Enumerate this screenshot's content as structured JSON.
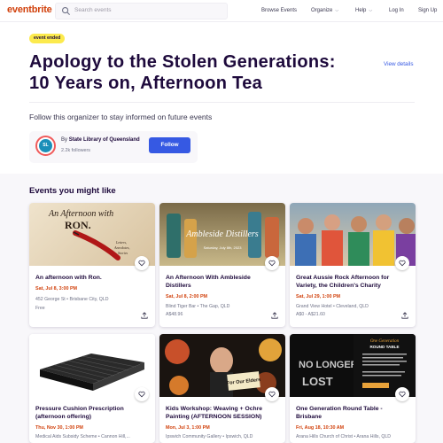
{
  "header": {
    "logo": "eventbrite",
    "search_placeholder": "Search events",
    "nav": [
      "Browse Events",
      "Organize",
      "Help",
      "Log In",
      "Sign Up"
    ]
  },
  "event": {
    "badge": "event ended",
    "title_line1": "Apology to the Stolen Generations:",
    "title_line2": "10 Years on, Afternoon Tea",
    "view_details": "View details"
  },
  "organizer": {
    "prompt": "Follow this organizer to stay informed on future events",
    "avatar_initials": "SL",
    "by_prefix": "By",
    "name": "State Library of Queensland",
    "followers": "2.2k followers",
    "follow_label": "Follow"
  },
  "related": {
    "heading": "Events you might like",
    "cards": [
      {
        "title": "An afternoon with Ron.",
        "date": "Sat, Jul 8, 3:00 PM",
        "venue": "452 George St • Brisbane City, QLD",
        "price": "Free",
        "image_text": "An Afternoon with RON."
      },
      {
        "title": "An Afternoon With Ambleside Distillers",
        "date": "Sat, Jul 8, 2:00 PM",
        "venue": "Blind Tiger Bar • The Gap, QLD",
        "price": "A$48.96",
        "image_text": "Ambleside Distillers"
      },
      {
        "title": "Great Aussie Rock Afternoon for Variety, the Children's Charity",
        "date": "Sat, Jul 29, 1:00 PM",
        "venue": "Grand View Hotel • Cleveland, QLD",
        "price": "A$0 - A$21.60",
        "image_text": ""
      },
      {
        "title": "Pressure Cushion Prescription (afternoon offering)",
        "date": "Thu, Nov 30, 1:00 PM",
        "venue": "Medical Aids Subsidy Scheme • Cannon Hill,...",
        "price": "",
        "image_text": ""
      },
      {
        "title": "Kids Workshop: Weaving + Ochre Painting (AFTERNOON SESSION)",
        "date": "Mon, Jul 3, 1:00 PM",
        "venue": "Ipswich Community Gallery • Ipswich, QLD",
        "price": "",
        "image_text": "For Our Elders"
      },
      {
        "title": "One Generation Round Table - Brisbane",
        "date": "Fri, Aug 18, 10:30 AM",
        "venue": "Arana Hills Church of Christ • Arana Hills, QLD",
        "price": "",
        "image_text": "One Generation Round Table"
      }
    ]
  },
  "colors": {
    "brand": "#d1410c",
    "accent": "#3659e3",
    "badge": "#fcea4d"
  }
}
